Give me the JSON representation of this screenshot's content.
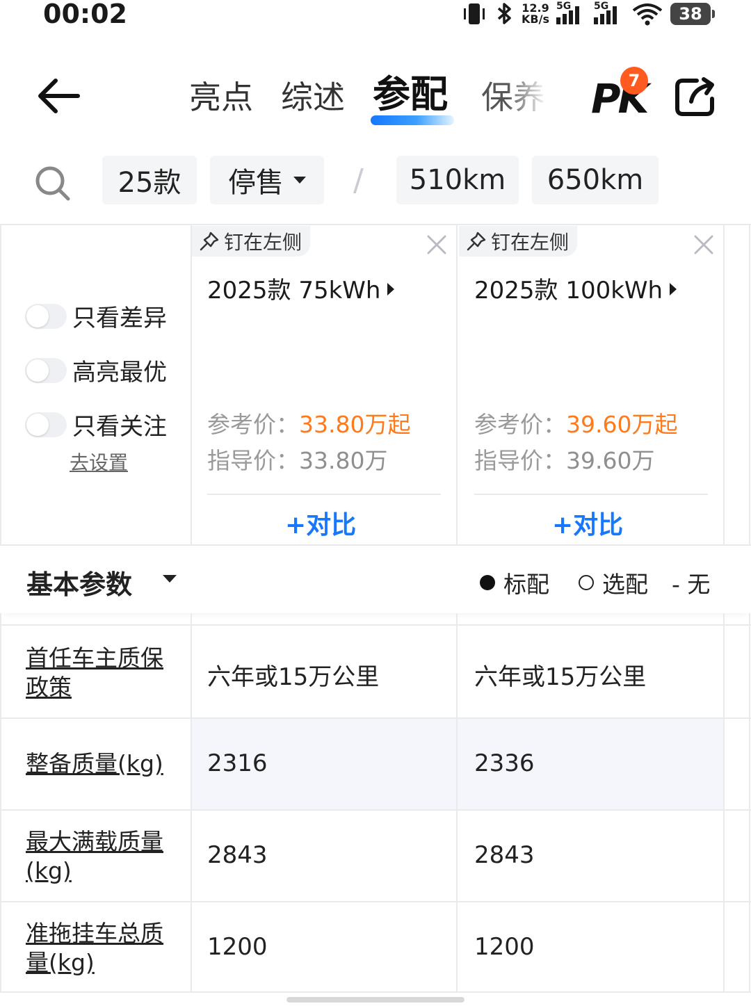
{
  "status_bar": {
    "time": "00:02",
    "net_speed_top": "12.9",
    "net_speed_bottom": "KB/s",
    "sim1": "5G",
    "sim2": "5G",
    "battery": "38"
  },
  "nav": {
    "tabs": [
      {
        "label": "亮点"
      },
      {
        "label": "综述"
      },
      {
        "label": "参配"
      },
      {
        "label": "保养"
      }
    ],
    "pk_label": "PK",
    "pk_count": "7"
  },
  "filters": {
    "year_chip": "25款",
    "status_chip": "停售",
    "separator": "/",
    "range_chips": [
      "510km",
      "650km"
    ]
  },
  "options": {
    "toggles": [
      {
        "label": "只看差异"
      },
      {
        "label": "高亮最优"
      },
      {
        "label": "只看关注"
      }
    ],
    "settings_link": "去设置"
  },
  "models": [
    {
      "pin_label": "钉在左侧",
      "name": "2025款 75kWh",
      "ref_price_label": "参考价：",
      "ref_price": "33.80万起",
      "guide_price_label": "指导价：",
      "guide_price": "33.80万",
      "compare_label": "+对比"
    },
    {
      "pin_label": "钉在左侧",
      "name": "2025款 100kWh",
      "ref_price_label": "参考价：",
      "ref_price": "39.60万起",
      "guide_price_label": "指导价：",
      "guide_price": "39.60万",
      "compare_label": "+对比"
    }
  ],
  "section": {
    "title": "基本参数",
    "legend": {
      "standard": "标配",
      "optional": "选配",
      "none": "- 无"
    }
  },
  "rows": [
    {
      "label": "首任车主质保政策",
      "values": [
        "六年或15万公里",
        "六年或15万公里"
      ]
    },
    {
      "label": "整备质量(kg)",
      "values": [
        "2316",
        "2336"
      ]
    },
    {
      "label": "最大满载质量(kg)",
      "values": [
        "2843",
        "2843"
      ]
    },
    {
      "label": "准拖挂车总质量(kg)",
      "values": [
        "1200",
        "1200"
      ]
    }
  ],
  "colors": {
    "accent": "#1677ff",
    "price_orange": "#ff7a1a",
    "badge_red": "#ff5a1f"
  }
}
